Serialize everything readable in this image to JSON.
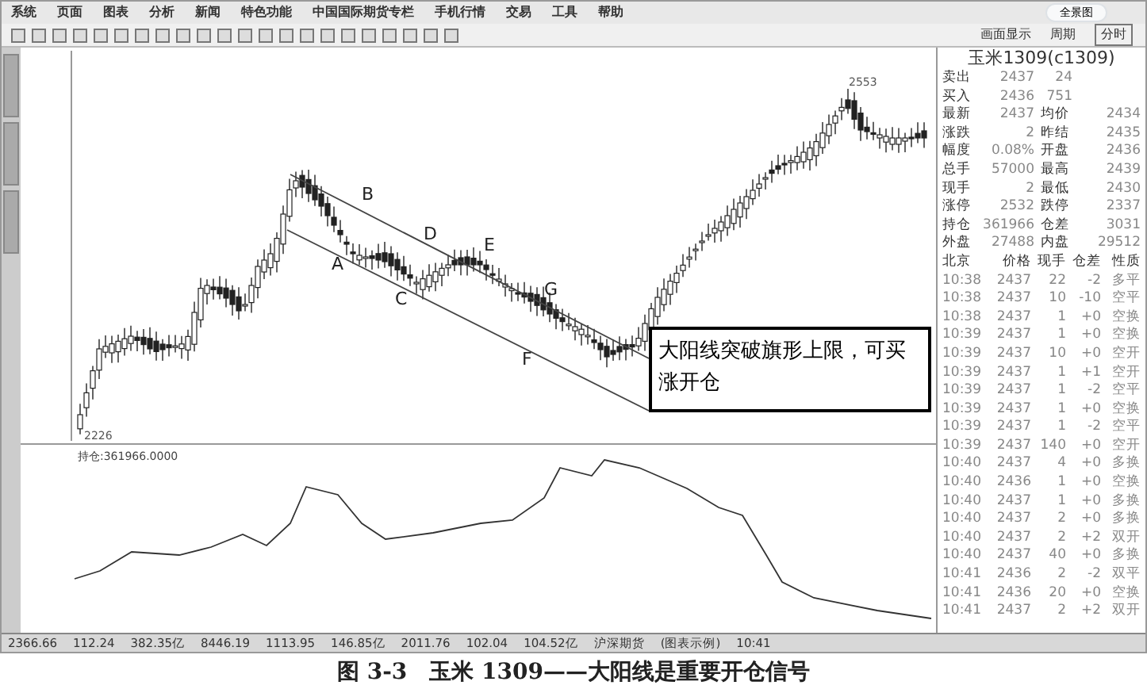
{
  "menu": [
    "系统",
    "页面",
    "图表",
    "分析",
    "新闻",
    "特色功能",
    "中国国际期货专栏",
    "手机行情",
    "交易",
    "工具",
    "帮助"
  ],
  "title_button": "全景图",
  "toolbar": {
    "labels": [
      "画面显示",
      "周期",
      "分时"
    ]
  },
  "quote": {
    "instrument": "玉米1309(c1309)",
    "book": [
      {
        "label": "卖出",
        "price": "2437",
        "volume": "24"
      },
      {
        "label": "买入",
        "price": "2436",
        "volume": "751"
      }
    ],
    "stats": [
      {
        "label": "最新",
        "value": "2437",
        "label2": "均价",
        "value2": "2434"
      },
      {
        "label": "涨跌",
        "value": "2",
        "label2": "昨结",
        "value2": "2435"
      },
      {
        "label": "幅度",
        "value": "0.08%",
        "label2": "开盘",
        "value2": "2436"
      },
      {
        "label": "总手",
        "value": "57000",
        "label2": "最高",
        "value2": "2439"
      },
      {
        "label": "现手",
        "value": "2",
        "label2": "最低",
        "value2": "2430"
      },
      {
        "label": "涨停",
        "value": "2532",
        "label2": "跌停",
        "value2": "2337"
      },
      {
        "label": "持仓",
        "value": "361966",
        "label2": "仓差",
        "value2": "3031"
      },
      {
        "label": "外盘",
        "value": "27488",
        "label2": "内盘",
        "value2": "29512"
      }
    ]
  },
  "ticks": {
    "columns": [
      "北京",
      "价格",
      "现手",
      "仓差",
      "性质"
    ],
    "rows": [
      [
        "10:38",
        "2437",
        "22",
        "-2",
        "多平"
      ],
      [
        "10:38",
        "2437",
        "10",
        "-10",
        "空平"
      ],
      [
        "10:38",
        "2437",
        "1",
        "+0",
        "空换"
      ],
      [
        "10:39",
        "2437",
        "1",
        "+0",
        "空换"
      ],
      [
        "10:39",
        "2437",
        "10",
        "+0",
        "空开"
      ],
      [
        "10:39",
        "2437",
        "1",
        "+1",
        "空开"
      ],
      [
        "10:39",
        "2437",
        "1",
        "-2",
        "空平"
      ],
      [
        "10:39",
        "2437",
        "1",
        "+0",
        "空换"
      ],
      [
        "10:39",
        "2437",
        "1",
        "-2",
        "空平"
      ],
      [
        "10:39",
        "2437",
        "140",
        "+0",
        "空开"
      ],
      [
        "10:40",
        "2437",
        "4",
        "+0",
        "多换"
      ],
      [
        "10:40",
        "2436",
        "1",
        "+0",
        "空换"
      ],
      [
        "10:40",
        "2437",
        "1",
        "+0",
        "多换"
      ],
      [
        "10:40",
        "2437",
        "2",
        "+0",
        "多换"
      ],
      [
        "10:40",
        "2437",
        "2",
        "+2",
        "双开"
      ],
      [
        "10:40",
        "2437",
        "40",
        "+0",
        "多换"
      ],
      [
        "10:41",
        "2436",
        "2",
        "-2",
        "双平"
      ],
      [
        "10:41",
        "2436",
        "20",
        "+0",
        "空换"
      ],
      [
        "10:41",
        "2437",
        "2",
        "+2",
        "双开"
      ]
    ]
  },
  "chart": {
    "point_labels": [
      "A",
      "B",
      "C",
      "D",
      "E",
      "F",
      "G"
    ],
    "low_label": "2226",
    "high_label": "2553",
    "annotation": "大阳线突破旗形上限，可买涨开仓",
    "indicator": "持仓:361966.0000"
  },
  "status_bar": [
    "2366.66",
    "112.24",
    "382.35亿",
    "8446.19",
    "1113.95",
    "146.85亿",
    "2011.76",
    "102.04",
    "104.52亿",
    "沪深期货",
    "(图表示例)",
    "10:41"
  ],
  "caption": "图 3-3　玉米 1309——大阳线是重要开仓信号"
}
